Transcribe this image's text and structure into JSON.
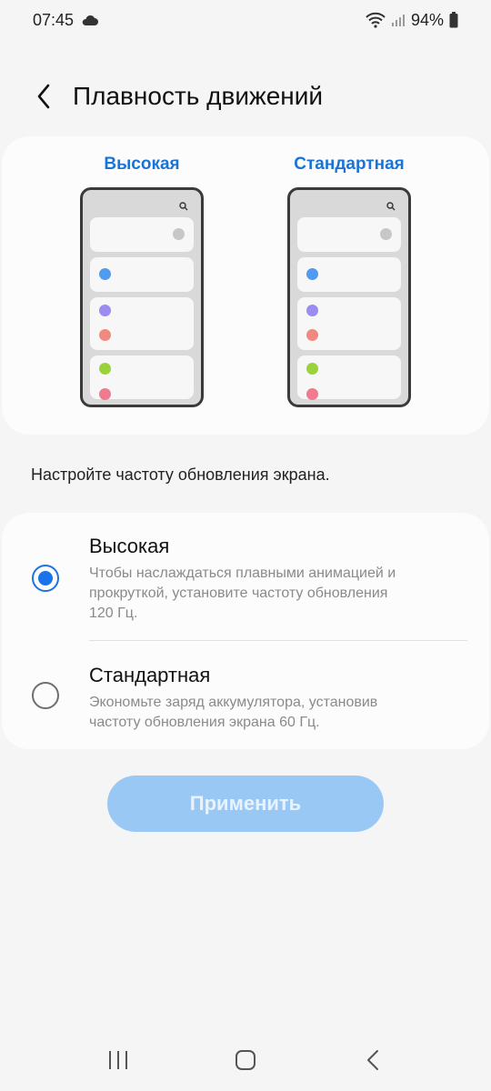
{
  "status_bar": {
    "time": "07:45",
    "battery": "94%",
    "icons": [
      "cloud-icon",
      "wifi-icon",
      "signal-icon",
      "battery-icon"
    ]
  },
  "header": {
    "title": "Плавность движений",
    "back_icon": "back-chevron-icon"
  },
  "preview": {
    "left_label": "Высокая",
    "right_label": "Стандартная",
    "dot_colors": {
      "gray": "#c7c7c7",
      "blue": "#4f9bf0",
      "purple": "#9a8cf0",
      "salmon": "#f08a7e",
      "green": "#9bd23c",
      "pink": "#f07a8e"
    }
  },
  "description": "Настройте частоту обновления экрана.",
  "options": [
    {
      "title": "Высокая",
      "desc_lines": [
        "Чтобы наслаждаться плавными анимацией и",
        "прокруткой, установите частоту обновления",
        "120 Гц."
      ],
      "selected": true
    },
    {
      "title": "Стандартная",
      "desc_lines": [
        "Экономьте заряд аккумулятора, установив",
        "частоту обновления экрана 60 Гц."
      ],
      "selected": false
    }
  ],
  "apply_button": "Применить",
  "nav": [
    "recent-apps-icon",
    "home-icon",
    "back-icon"
  ],
  "colors": {
    "accent": "#1a73e8",
    "label_blue": "#1a73d6",
    "button_disabled": "#9ac8f5"
  }
}
